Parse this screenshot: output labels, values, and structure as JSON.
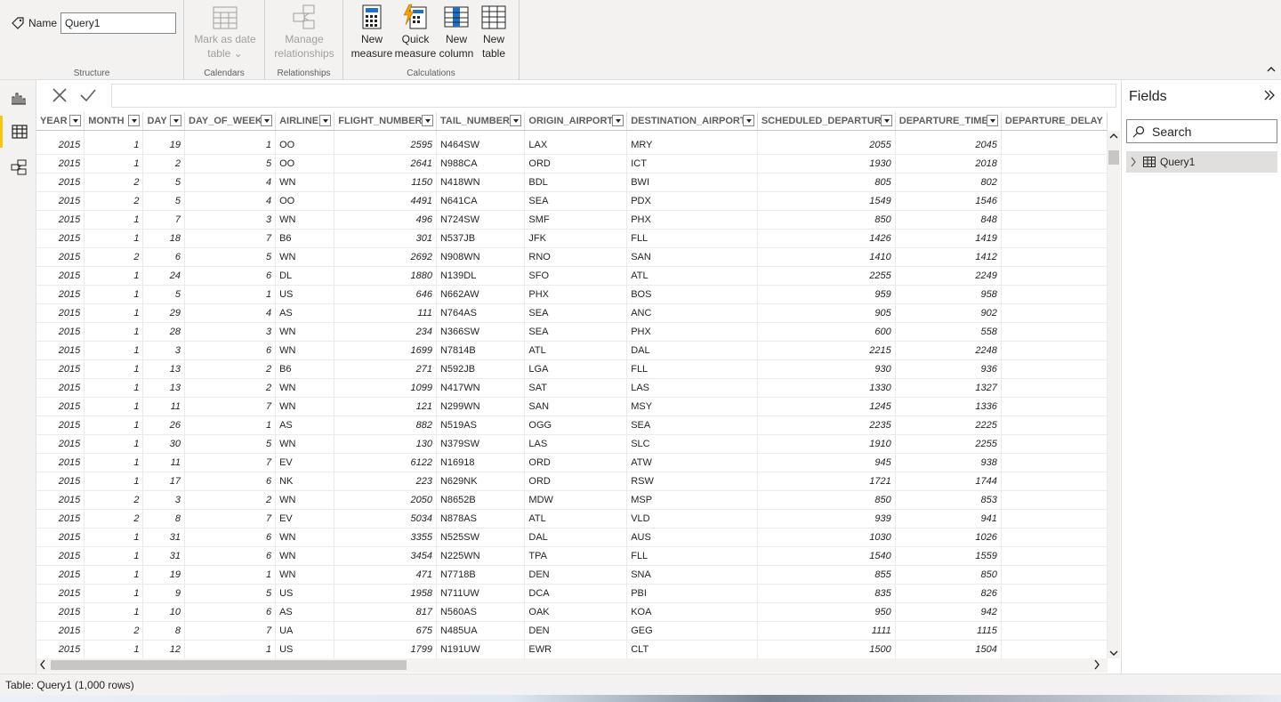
{
  "ribbon": {
    "name_label": "Name",
    "name_value": "Query1",
    "groups": {
      "structure": "Structure",
      "calendars": "Calendars",
      "relationships": "Relationships",
      "calculations": "Calculations"
    },
    "buttons": {
      "mark_as_date_table": [
        "Mark as date",
        "table ⌄"
      ],
      "manage_relationships": [
        "Manage",
        "relationships"
      ],
      "new_measure": [
        "New",
        "measure"
      ],
      "quick_measure": [
        "Quick",
        "measure"
      ],
      "new_column": [
        "New",
        "column"
      ],
      "new_table": [
        "New",
        "table"
      ]
    }
  },
  "columns": [
    {
      "name": "YEAR",
      "align": "num"
    },
    {
      "name": "MONTH",
      "align": "num"
    },
    {
      "name": "DAY",
      "align": "num"
    },
    {
      "name": "DAY_OF_WEEK",
      "align": "num"
    },
    {
      "name": "AIRLINE",
      "align": "txt"
    },
    {
      "name": "FLIGHT_NUMBER",
      "align": "num"
    },
    {
      "name": "TAIL_NUMBER",
      "align": "txt"
    },
    {
      "name": "ORIGIN_AIRPORT",
      "align": "txt"
    },
    {
      "name": "DESTINATION_AIRPORT",
      "align": "txt"
    },
    {
      "name": "SCHEDULED_DEPARTURE",
      "align": "num"
    },
    {
      "name": "DEPARTURE_TIME",
      "align": "num"
    },
    {
      "name": "DEPARTURE_DELAY",
      "align": "num"
    }
  ],
  "rows": [
    [
      "2015",
      "1",
      "19",
      "1",
      "OO",
      "2595",
      "N464SW",
      "LAX",
      "MRY",
      "2055",
      "2045",
      ""
    ],
    [
      "2015",
      "1",
      "2",
      "5",
      "OO",
      "2641",
      "N988CA",
      "ORD",
      "ICT",
      "1930",
      "2018",
      ""
    ],
    [
      "2015",
      "2",
      "5",
      "4",
      "WN",
      "1150",
      "N418WN",
      "BDL",
      "BWI",
      "805",
      "802",
      ""
    ],
    [
      "2015",
      "2",
      "5",
      "4",
      "OO",
      "4491",
      "N641CA",
      "SEA",
      "PDX",
      "1549",
      "1546",
      ""
    ],
    [
      "2015",
      "1",
      "7",
      "3",
      "WN",
      "496",
      "N724SW",
      "SMF",
      "PHX",
      "850",
      "848",
      ""
    ],
    [
      "2015",
      "1",
      "18",
      "7",
      "B6",
      "301",
      "N537JB",
      "JFK",
      "FLL",
      "1426",
      "1419",
      ""
    ],
    [
      "2015",
      "2",
      "6",
      "5",
      "WN",
      "2692",
      "N908WN",
      "RNO",
      "SAN",
      "1410",
      "1412",
      ""
    ],
    [
      "2015",
      "1",
      "24",
      "6",
      "DL",
      "1880",
      "N139DL",
      "SFO",
      "ATL",
      "2255",
      "2249",
      ""
    ],
    [
      "2015",
      "1",
      "5",
      "1",
      "US",
      "646",
      "N662AW",
      "PHX",
      "BOS",
      "959",
      "958",
      ""
    ],
    [
      "2015",
      "1",
      "29",
      "4",
      "AS",
      "111",
      "N764AS",
      "SEA",
      "ANC",
      "905",
      "902",
      ""
    ],
    [
      "2015",
      "1",
      "28",
      "3",
      "WN",
      "234",
      "N366SW",
      "SEA",
      "PHX",
      "600",
      "558",
      ""
    ],
    [
      "2015",
      "1",
      "3",
      "6",
      "WN",
      "1699",
      "N7814B",
      "ATL",
      "DAL",
      "2215",
      "2248",
      ""
    ],
    [
      "2015",
      "1",
      "13",
      "2",
      "B6",
      "271",
      "N592JB",
      "LGA",
      "FLL",
      "930",
      "936",
      ""
    ],
    [
      "2015",
      "1",
      "13",
      "2",
      "WN",
      "1099",
      "N417WN",
      "SAT",
      "LAS",
      "1330",
      "1327",
      ""
    ],
    [
      "2015",
      "1",
      "11",
      "7",
      "WN",
      "121",
      "N299WN",
      "SAN",
      "MSY",
      "1245",
      "1336",
      ""
    ],
    [
      "2015",
      "1",
      "26",
      "1",
      "AS",
      "882",
      "N519AS",
      "OGG",
      "SEA",
      "2235",
      "2225",
      ""
    ],
    [
      "2015",
      "1",
      "30",
      "5",
      "WN",
      "130",
      "N379SW",
      "LAS",
      "SLC",
      "1910",
      "2255",
      ""
    ],
    [
      "2015",
      "1",
      "11",
      "7",
      "EV",
      "6122",
      "N16918",
      "ORD",
      "ATW",
      "945",
      "938",
      ""
    ],
    [
      "2015",
      "1",
      "17",
      "6",
      "NK",
      "223",
      "N629NK",
      "ORD",
      "RSW",
      "1721",
      "1744",
      ""
    ],
    [
      "2015",
      "2",
      "3",
      "2",
      "WN",
      "2050",
      "N8652B",
      "MDW",
      "MSP",
      "850",
      "853",
      ""
    ],
    [
      "2015",
      "2",
      "8",
      "7",
      "EV",
      "5034",
      "N878AS",
      "ATL",
      "VLD",
      "939",
      "941",
      ""
    ],
    [
      "2015",
      "1",
      "31",
      "6",
      "WN",
      "3355",
      "N525SW",
      "DAL",
      "AUS",
      "1030",
      "1026",
      ""
    ],
    [
      "2015",
      "1",
      "31",
      "6",
      "WN",
      "3454",
      "N225WN",
      "TPA",
      "FLL",
      "1540",
      "1559",
      ""
    ],
    [
      "2015",
      "1",
      "19",
      "1",
      "WN",
      "471",
      "N7718B",
      "DEN",
      "SNA",
      "855",
      "850",
      ""
    ],
    [
      "2015",
      "1",
      "9",
      "5",
      "US",
      "1958",
      "N711UW",
      "DCA",
      "PBI",
      "835",
      "826",
      ""
    ],
    [
      "2015",
      "1",
      "10",
      "6",
      "AS",
      "817",
      "N560AS",
      "OAK",
      "KOA",
      "950",
      "942",
      ""
    ],
    [
      "2015",
      "2",
      "8",
      "7",
      "UA",
      "675",
      "N485UA",
      "DEN",
      "GEG",
      "1111",
      "1115",
      ""
    ],
    [
      "2015",
      "1",
      "12",
      "1",
      "US",
      "1799",
      "N191UW",
      "EWR",
      "CLT",
      "1500",
      "1504",
      ""
    ]
  ],
  "fields": {
    "title": "Fields",
    "search_placeholder": "Search",
    "tables": [
      "Query1"
    ]
  },
  "status": {
    "text": "Table: Query1 (1,000 rows)"
  }
}
